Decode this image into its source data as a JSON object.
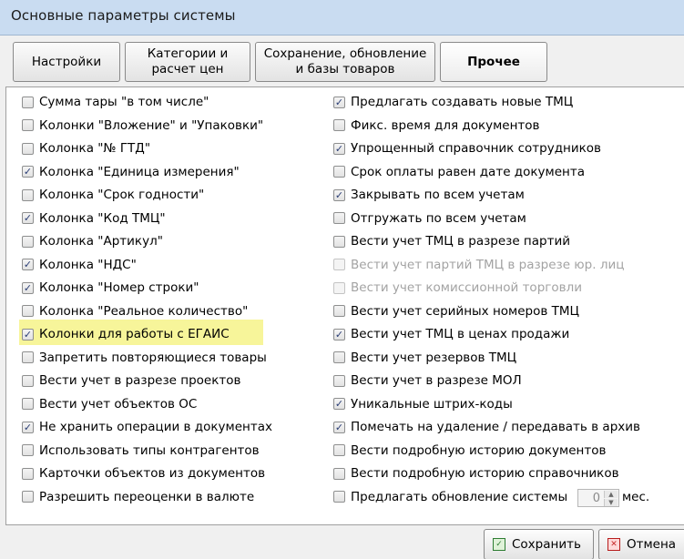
{
  "window": {
    "title": "Основные параметры системы"
  },
  "tabs": [
    {
      "label": "Настройки",
      "active": false
    },
    {
      "label": "Категории и\nрасчет цен",
      "active": false
    },
    {
      "label": "Сохранение, обновление\nи базы товаров",
      "active": false
    },
    {
      "label": "Прочее",
      "active": true
    }
  ],
  "left_options": [
    {
      "label": "Сумма тары \"в том числе\"",
      "checked": false
    },
    {
      "label": "Колонки \"Вложение\" и \"Упаковки\"",
      "checked": false
    },
    {
      "label": "Колонка \"№ ГТД\"",
      "checked": false
    },
    {
      "label": "Колонка \"Единица измерения\"",
      "checked": true
    },
    {
      "label": "Колонка \"Срок годности\"",
      "checked": false
    },
    {
      "label": "Колонка \"Код ТМЦ\"",
      "checked": true
    },
    {
      "label": "Колонка \"Артикул\"",
      "checked": false
    },
    {
      "label": "Колонка \"НДС\"",
      "checked": true
    },
    {
      "label": "Колонка \"Номер строки\"",
      "checked": true
    },
    {
      "label": "Колонка \"Реальное количество\"",
      "checked": false
    },
    {
      "label": "Колонки для работы с ЕГАИС",
      "checked": true,
      "highlighted": true
    },
    {
      "label": "Запретить повторяющиеся товары",
      "checked": false
    },
    {
      "label": "Вести учет в разрезе  проектов",
      "checked": false
    },
    {
      "label": "Вести учет объектов ОС",
      "checked": false
    },
    {
      "label": "Не хранить операции в документах",
      "checked": true
    },
    {
      "label": "Использовать типы контрагентов",
      "checked": false
    },
    {
      "label": "Карточки объектов из документов",
      "checked": false
    },
    {
      "label": "Разрешить переоценки в валюте",
      "checked": false
    }
  ],
  "right_options": [
    {
      "label": "Предлагать создавать новые ТМЦ",
      "checked": true,
      "disabled": false
    },
    {
      "label": "Фикс. время для документов",
      "checked": false,
      "disabled": false
    },
    {
      "label": "Упрощенный справочник сотрудников",
      "checked": true,
      "disabled": false
    },
    {
      "label": "Срок оплаты равен дате документа",
      "checked": false,
      "disabled": false
    },
    {
      "label": "Закрывать по всем учетам",
      "checked": true,
      "disabled": false
    },
    {
      "label": "Отгружать по всем учетам",
      "checked": false,
      "disabled": false
    },
    {
      "label": "Вести учет ТМЦ в разрезе партий",
      "checked": false,
      "disabled": false
    },
    {
      "label": "Вести учет партий ТМЦ в разрезе юр. лиц",
      "checked": false,
      "disabled": true
    },
    {
      "label": "Вести учет комиссионной торговли",
      "checked": false,
      "disabled": true
    },
    {
      "label": "Вести учет серийных номеров ТМЦ",
      "checked": false,
      "disabled": false
    },
    {
      "label": "Вести учет ТМЦ в ценах продажи",
      "checked": true,
      "disabled": false
    },
    {
      "label": "Вести учет резервов ТМЦ",
      "checked": false,
      "disabled": false
    },
    {
      "label": "Вести учет в разрезе МОЛ",
      "checked": false,
      "disabled": false
    },
    {
      "label": "Уникальные штрих-коды",
      "checked": true,
      "disabled": false
    },
    {
      "label": "Помечать на удаление / передавать в архив",
      "checked": true,
      "disabled": false
    },
    {
      "label": "Вести подробную историю документов",
      "checked": false,
      "disabled": false
    },
    {
      "label": "Вести подробную историю справочников",
      "checked": false,
      "disabled": false
    },
    {
      "label": "Предлагать обновление системы",
      "checked": false,
      "disabled": false
    }
  ],
  "update_spinner": {
    "value": "0",
    "unit": "мес."
  },
  "buttons": {
    "save": "Сохранить",
    "cancel": "Отмена"
  },
  "icons": {
    "checkmark": "checkmark-icon",
    "spin_up": "spin-up-icon",
    "spin_down": "spin-down-icon",
    "save": "save-icon",
    "cancel": "cancel-icon"
  },
  "colors": {
    "title_bar": "#c9dcf1",
    "highlight": "#f7f59a",
    "checkmark": "#2a3d75",
    "disabled_text": "#a3a3a3"
  }
}
